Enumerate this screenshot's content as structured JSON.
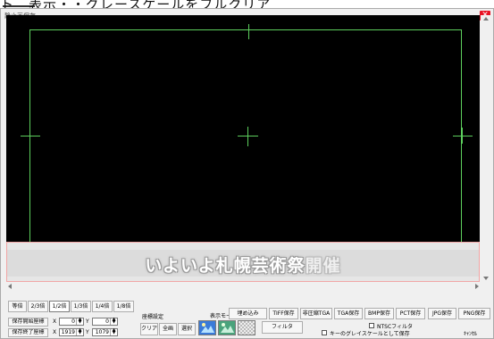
{
  "top_strip": {
    "text": "ト　表示・・グレースケールをフルクリア"
  },
  "window": {
    "title": "静止画保存",
    "close_icon": "close-icon"
  },
  "caption": {
    "main": "いよいよ札幌芸術祭",
    "tail": "開催"
  },
  "zoom_buttons": [
    "等倍",
    "2/3倍",
    "1/2倍",
    "1/3倍",
    "1/4倍",
    "1/8倍"
  ],
  "zoom_selected": "1/2倍",
  "coords": {
    "start_label": "保存開始座標",
    "end_label": "保存終了座標",
    "x_label": "X",
    "y_label": "Y",
    "start_x": "0",
    "start_y": "0",
    "end_x": "1919",
    "end_y": "1079"
  },
  "range": {
    "label": "座標設定",
    "clear": "クリア",
    "all": "全画",
    "select": "選択"
  },
  "display_mode": {
    "label": "表示モード",
    "filter": "フィルタ"
  },
  "save_buttons": [
    "埋め込み",
    "TIFF保存",
    "非圧縮TGA",
    "TGA保存",
    "BMP保存",
    "PCT保存",
    "JPG保存",
    "PNG保存"
  ],
  "options": {
    "ntsc_filter": "NTSCフィルタ",
    "key_grayscale": "キーのグレイスケールとして保存"
  },
  "cancel": "ｷｬﾝｾﾙ",
  "colors": {
    "guide": "#5dcf5d",
    "preview_bg": "#000000",
    "accent_close": "#e81123"
  }
}
